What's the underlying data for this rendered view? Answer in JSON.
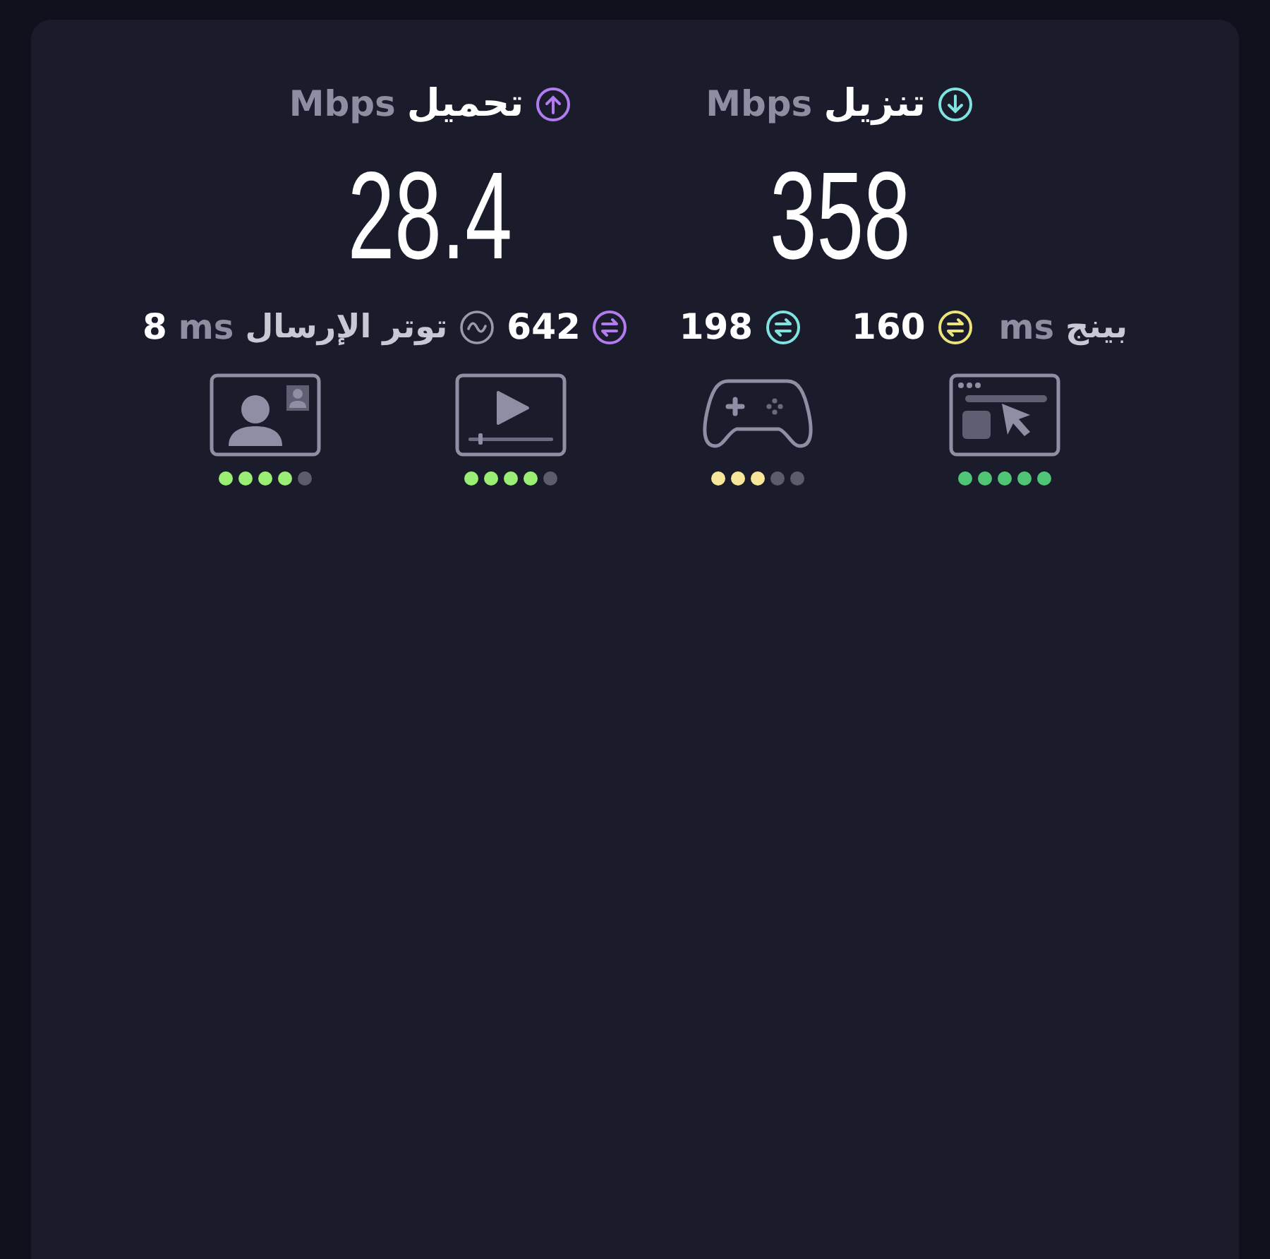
{
  "speeds": [
    {
      "kind": "download",
      "label": "تنزيل",
      "unit": "Mbps",
      "value": "358",
      "color": "#7fe3e0"
    },
    {
      "kind": "upload",
      "label": "تحميل",
      "unit": "Mbps",
      "value": "28.4",
      "color": "#b07cf0"
    }
  ],
  "ping": {
    "label": "بينج",
    "unit": "ms",
    "readings": [
      {
        "value": "160",
        "color": "#ece37a"
      },
      {
        "value": "198",
        "color": "#7fe3e0"
      },
      {
        "value": "642",
        "color": "#b07cf0"
      }
    ]
  },
  "jitter": {
    "label": "توتر الإرسال",
    "unit": "ms",
    "value": "8"
  },
  "quality": [
    {
      "kind": "browsing",
      "stars": 5,
      "color": "#4fc575"
    },
    {
      "kind": "gaming",
      "stars": 3,
      "color": "#f7e69a"
    },
    {
      "kind": "video",
      "stars": 4,
      "color": "#9bee74"
    },
    {
      "kind": "video-call",
      "stars": 4,
      "color": "#9bee74"
    }
  ]
}
